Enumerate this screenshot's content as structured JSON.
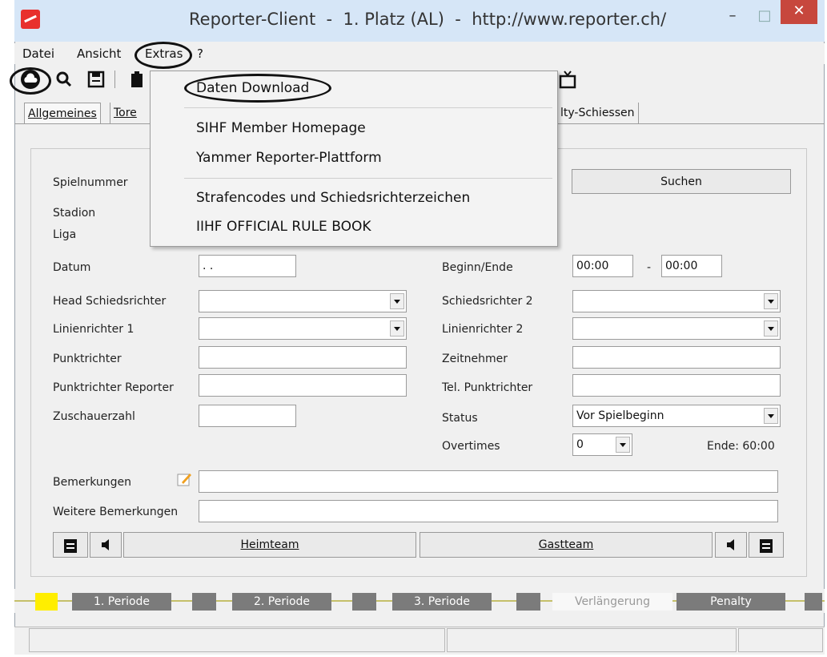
{
  "window": {
    "title": "Reporter-Client  -  1. Platz (AL)  -  http://www.reporter.ch/",
    "minimize_glyph": "–",
    "maximize_glyph": "□",
    "close_glyph": "✕"
  },
  "menubar": {
    "items": [
      "Datei",
      "Ansicht",
      "Extras",
      "?"
    ]
  },
  "toolbar": {
    "icons": [
      "cloud-download-icon",
      "search-icon",
      "save-icon",
      "clipboard-icon",
      "tv-icon"
    ]
  },
  "tabs": {
    "items": [
      "Allgemeines",
      "Tore",
      "lty-Schiessen"
    ]
  },
  "extras_menu": {
    "items": [
      "Daten Download",
      "SIHF Member Homepage",
      "Yammer Reporter-Plattform",
      "Strafencodes und Schiedsrichterzeichen",
      "IIHF OFFICIAL RULE BOOK"
    ]
  },
  "form": {
    "spielnummer_label": "Spielnummer",
    "stadion_label": "Stadion",
    "liga_label": "Liga",
    "suchen_button": "Suchen",
    "datum_label": "Datum",
    "datum_value": " . .",
    "beginn_ende_label": "Beginn/Ende",
    "beginn_value": "00:00",
    "dash": "-",
    "ende_value": "00:00",
    "head_schiedsrichter_label": "Head Schiedsrichter",
    "schiedsrichter2_label": "Schiedsrichter 2",
    "linienrichter1_label": "Linienrichter 1",
    "linienrichter2_label": "Linienrichter 2",
    "punktrichter_label": "Punktrichter",
    "zeitnehmer_label": "Zeitnehmer",
    "punktrichter_reporter_label": "Punktrichter Reporter",
    "tel_punktrichter_label": "Tel. Punktrichter",
    "zuschauerzahl_label": "Zuschauerzahl",
    "status_label": "Status",
    "status_value": "Vor Spielbeginn",
    "overtimes_label": "Overtimes",
    "overtimes_value": "0",
    "ende_time": "Ende: 60:00",
    "bemerkungen_label": "Bemerkungen",
    "weitere_bemerkungen_label": "Weitere Bemerkungen",
    "heimteam_button": "Heimteam",
    "gastteam_button": "Gastteam"
  },
  "phases": {
    "items": [
      "1. Periode",
      "2. Periode",
      "3. Periode",
      "Verlängerung",
      "Penalty"
    ],
    "active_color": "#ffee00"
  }
}
